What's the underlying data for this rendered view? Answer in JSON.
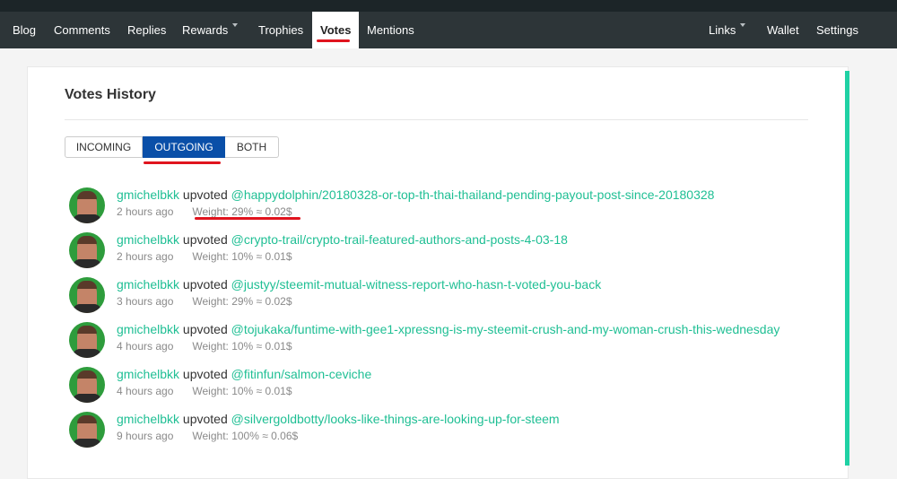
{
  "nav": {
    "left": [
      {
        "label": "Blog"
      },
      {
        "label": "Comments"
      },
      {
        "label": "Replies"
      },
      {
        "label": "Rewards"
      },
      {
        "label": "Trophies"
      },
      {
        "label": "Votes",
        "active": true
      },
      {
        "label": "Mentions"
      }
    ],
    "right": [
      {
        "label": "Links"
      },
      {
        "label": "Wallet"
      },
      {
        "label": "Settings"
      }
    ]
  },
  "colors": {
    "accent": "#1fd1a4",
    "link": "#1fbf94",
    "active_tab": "#0a4fa8",
    "nav_bg": "#2d3538",
    "annotation": "#e0141e"
  },
  "page": {
    "title": "Votes History"
  },
  "tabs": [
    {
      "label": "INCOMING"
    },
    {
      "label": "OUTGOING",
      "selected": true
    },
    {
      "label": "BOTH"
    }
  ],
  "votes": [
    {
      "voter": "gmichelbkk",
      "action": "upvoted",
      "post": "@happydolphin/20180328-or-top-th-thai-thailand-pending-payout-post-since-20180328",
      "time": "2 hours ago",
      "weight": "Weight: 29% ≈ 0.02$"
    },
    {
      "voter": "gmichelbkk",
      "action": "upvoted",
      "post": "@crypto-trail/crypto-trail-featured-authors-and-posts-4-03-18",
      "time": "2 hours ago",
      "weight": "Weight: 10% ≈ 0.01$"
    },
    {
      "voter": "gmichelbkk",
      "action": "upvoted",
      "post": "@justyy/steemit-mutual-witness-report-who-hasn-t-voted-you-back",
      "time": "3 hours ago",
      "weight": "Weight: 29% ≈ 0.02$"
    },
    {
      "voter": "gmichelbkk",
      "action": "upvoted",
      "post": "@tojukaka/funtime-with-gee1-xpressng-is-my-steemit-crush-and-my-woman-crush-this-wednesday",
      "time": "4 hours ago",
      "weight": "Weight: 10% ≈ 0.01$"
    },
    {
      "voter": "gmichelbkk",
      "action": "upvoted",
      "post": "@fitinfun/salmon-ceviche",
      "time": "4 hours ago",
      "weight": "Weight: 10% ≈ 0.01$"
    },
    {
      "voter": "gmichelbkk",
      "action": "upvoted",
      "post": "@silvergoldbotty/looks-like-things-are-looking-up-for-steem",
      "time": "9 hours ago",
      "weight": "Weight: 100% ≈ 0.06$"
    }
  ]
}
